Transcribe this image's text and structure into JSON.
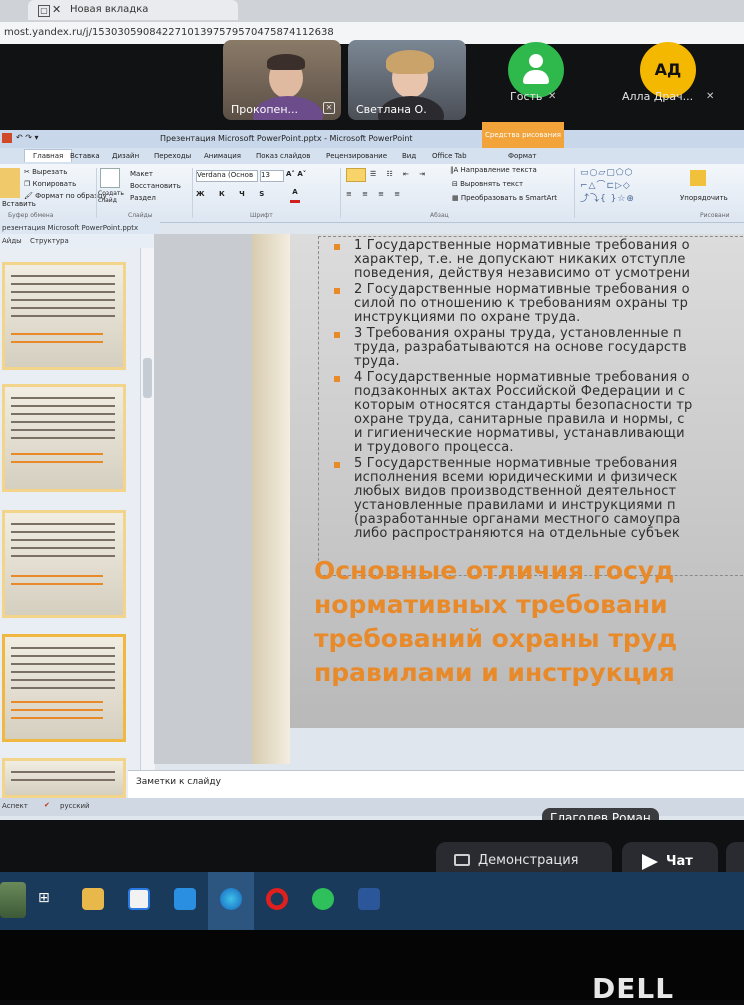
{
  "browser": {
    "tab_title": "Новая вкладка",
    "address": "most.yandex.ru/j/15303059084227101397579570475874112638"
  },
  "call": {
    "participants": [
      {
        "name": "Прокопен..."
      },
      {
        "name": "Светлана О."
      },
      {
        "name": "Гость"
      },
      {
        "name": "Алла Драч...",
        "initials": "АД"
      }
    ],
    "speaker": "Глаголев Роман",
    "controls": {
      "demo_label": "Демонстрация",
      "chat_label": "Чат"
    }
  },
  "ppt": {
    "window_title": "Презентация Microsoft PowerPoint.pptx  -  Microsoft PowerPoint",
    "contextual_tab": "Средства рисования",
    "tabs": [
      "Главная",
      "Вставка",
      "Дизайн",
      "Переходы",
      "Анимация",
      "Показ слайдов",
      "Рецензирование",
      "Вид",
      "Office Tab",
      "Формат"
    ],
    "ribbon": {
      "vyrezat": "Вырезать",
      "kopirovat": "Копировать",
      "format_po_obrazcu": "Формат по образцу",
      "vstavit": "Вставить",
      "sozdat_slaid": "Создать слайд",
      "maket": "Макет",
      "vosstanovit": "Восстановить",
      "razdel": "Раздел",
      "font_name": "Verdana (Основ",
      "font_size": "13",
      "napravlenie_teksta": "Направление текста",
      "vyrovnyat_tekst": "Выровнять текст",
      "preobrazovat": "Преобразовать в SmartArt",
      "uporyadochit": "Упорядочить",
      "groups": {
        "bufer": "Буфер обмена",
        "slaidy": "Слайды",
        "shrift": "Шрифт",
        "abzac": "Абзац",
        "risovanie": "Рисовани"
      }
    },
    "doc_tab": "резентация Microsoft PowerPoint.pptx",
    "pane_tabs": [
      "Айды",
      "Структура"
    ],
    "notes_label": "Заметки к слайду",
    "status": {
      "view": "Аспект",
      "language": "русский"
    },
    "slide": {
      "bullets": [
        [
          "1 Государственные нормативные требования о",
          "характер, т.е. не допускают никаких отступле",
          "поведения, действуя независимо от усмотрени"
        ],
        [
          "2 Государственные нормативные требования о",
          "силой по отношению к требованиям охраны тр",
          "инструкциями по охране труда."
        ],
        [
          "3 Требования охраны труда, установленные п",
          "труда, разрабатываются на основе государств",
          "труда."
        ],
        [
          "4 Государственные нормативные требования о",
          "подзаконных актах Российской Федерации и с",
          "которым относятся стандарты безопасности тр",
          "охране труда, санитарные правила и нормы, с",
          "и гигиенические нормативы, устанавливающи",
          "и трудового процесса."
        ],
        [
          "5 Государственные нормативные требования",
          "исполнения всеми юридическими и физическ",
          "любых видов производственной деятельност",
          "установленные правилами и инструкциями п",
          "(разработанные органами местного самоупра",
          "либо распространяются на отдельные субъек"
        ]
      ],
      "heading": [
        "Основные отличия госуд",
        "нормативных требовани",
        "требований охраны труд",
        "правилами и инструкция"
      ]
    }
  },
  "colors": {
    "accent_orange": "#e8892a",
    "guest_green": "#2fb84c",
    "avatar_yellow": "#f5b800"
  },
  "monitor": {
    "brand": "DELL"
  }
}
